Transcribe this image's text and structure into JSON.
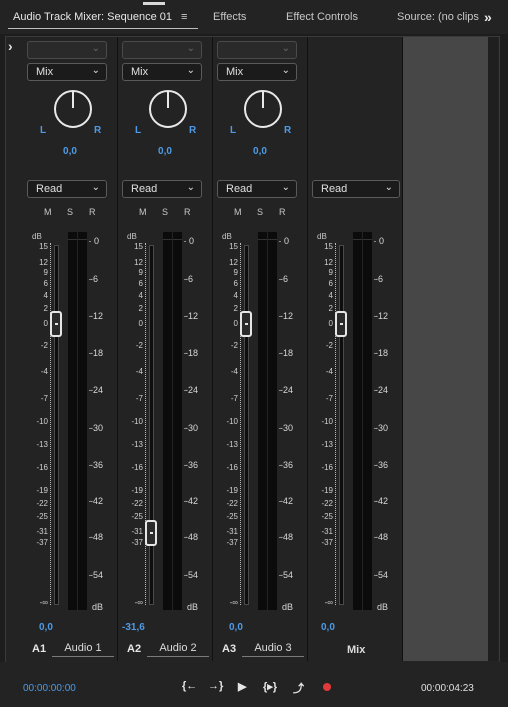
{
  "tabs": [
    {
      "label": "Audio Track Mixer: Sequence 01"
    },
    {
      "label": "Effects"
    },
    {
      "label": "Effect Controls"
    },
    {
      "label": "Source: (no clips"
    }
  ],
  "icons": {
    "menu": "≡",
    "more": "»",
    "expand": "›",
    "chevron": "⌄"
  },
  "channels": [
    {
      "id": "A1",
      "name": "Audio 1",
      "input": "",
      "mode": "Mix",
      "pan": "0,0",
      "automation": "Read",
      "volume": "0,0",
      "fader_db": 0
    },
    {
      "id": "A2",
      "name": "Audio 2",
      "input": "",
      "mode": "Mix",
      "pan": "0,0",
      "automation": "Read",
      "volume": "-31,6",
      "fader_db": -31.6
    },
    {
      "id": "A3",
      "name": "Audio 3",
      "input": "",
      "mode": "Mix",
      "pan": "0,0",
      "automation": "Read",
      "volume": "0,0",
      "fader_db": 0
    }
  ],
  "mix": {
    "automation": "Read",
    "volume": "0,0",
    "name": "Mix",
    "fader_db": 0
  },
  "labels": {
    "L": "L",
    "R": "R",
    "M": "M",
    "S": "S",
    "Rd": "R",
    "db": "dB"
  },
  "fader_scale": [
    "15",
    "12",
    "9",
    "6",
    "4",
    "2",
    "0",
    "-2",
    "-4",
    "-7",
    "-10",
    "-13",
    "-16",
    "-19",
    "-22",
    "-25",
    "-31",
    "-37",
    "-∞"
  ],
  "meter_scale": [
    "0",
    "-6",
    "-12",
    "-18",
    "-24",
    "-30",
    "-36",
    "-42",
    "-48",
    "-54",
    "dB"
  ],
  "transport": {
    "timecode_left": "00:00:00:00",
    "timecode_right": "00:00:04:23",
    "buttons": [
      "{←",
      "→}",
      "▶",
      "{▸}",
      "⤴",
      "●"
    ]
  },
  "colors": {
    "accent": "#4d9be6",
    "record": "#e23a3a"
  }
}
